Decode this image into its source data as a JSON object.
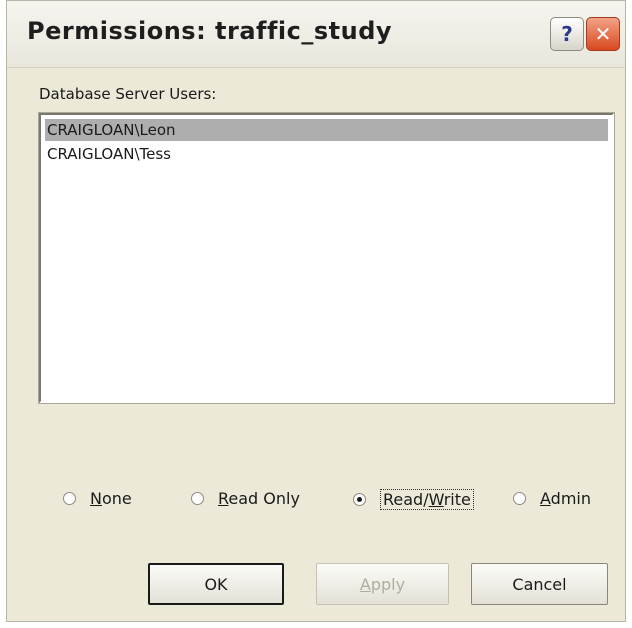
{
  "window": {
    "title": "Permissions:  traffic_study",
    "help_glyph": "?",
    "close_glyph": "✕"
  },
  "users_label": "Database Server Users:",
  "users": [
    {
      "name": "CRAIGLOAN\\Leon",
      "selected": true
    },
    {
      "name": "CRAIGLOAN\\Tess",
      "selected": false
    }
  ],
  "permissions": {
    "selected": "Read/Write",
    "options": [
      {
        "label": "None",
        "access_key": "N",
        "rest": "one"
      },
      {
        "label": "Read Only",
        "access_key": "R",
        "rest": "ead Only"
      },
      {
        "label": "Read/Write",
        "pre": "Read/",
        "access_key": "W",
        "rest": "rite"
      },
      {
        "label": "Admin",
        "access_key": "A",
        "rest": "dmin"
      }
    ]
  },
  "buttons": {
    "ok": "OK",
    "apply_key": "A",
    "apply_rest": "pply",
    "cancel": "Cancel"
  },
  "colors": {
    "dialog_bg": "#ece9d8",
    "selection": "#aeaeae",
    "close_button": "#d9491f"
  },
  "icons": {
    "help": "help-icon",
    "close": "close-icon",
    "radio": "radio-icon"
  }
}
